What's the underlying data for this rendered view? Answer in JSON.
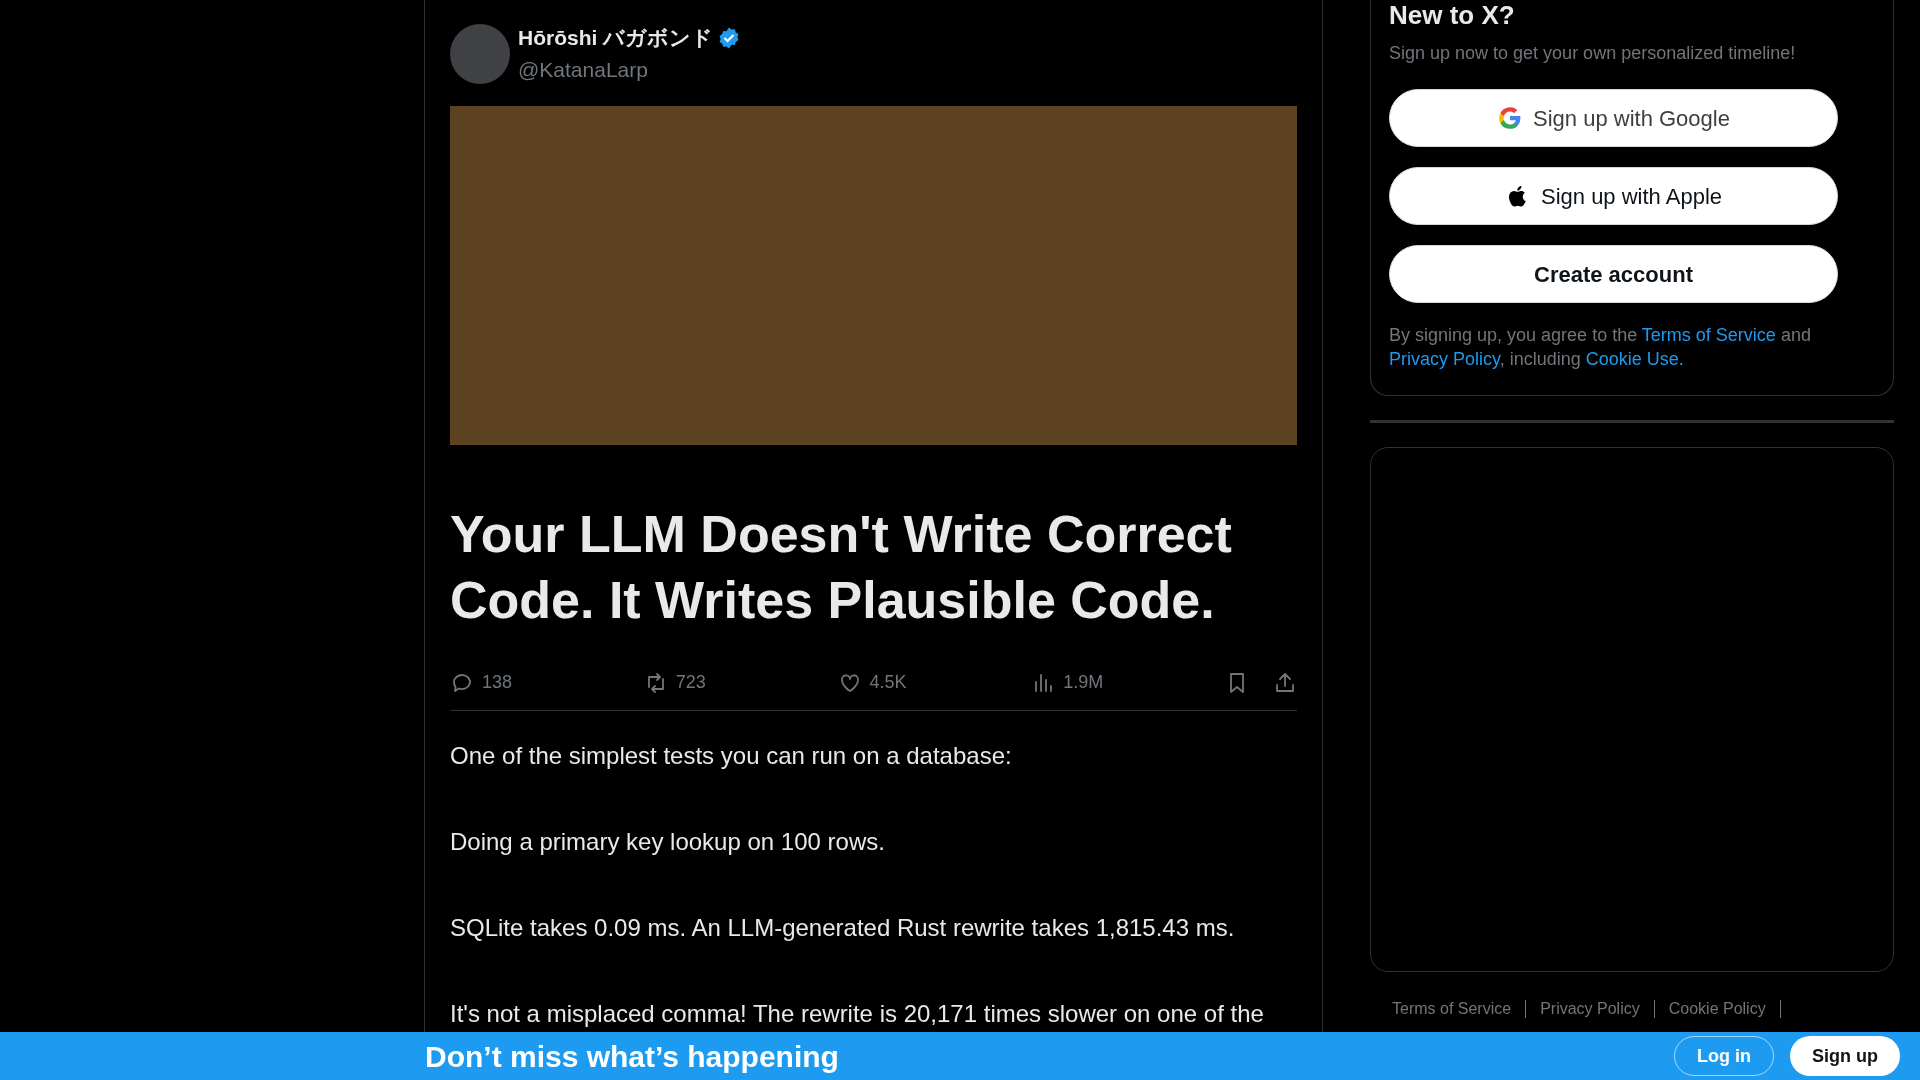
{
  "tweet": {
    "author": {
      "name": "Hōrōshi バガボンド",
      "verified": true,
      "handle": "@KatanaLarp"
    },
    "headline": "Your LLM Doesn't Write Correct Code. It Writes Plausible Code.",
    "actions": [
      {
        "kind": "reply",
        "count": "138"
      },
      {
        "kind": "repost",
        "count": "723"
      },
      {
        "kind": "like",
        "count": "4.5K"
      },
      {
        "kind": "views",
        "count": "1.9M"
      }
    ],
    "paragraphs": [
      "One of the simplest tests you can run on a database:",
      "Doing a primary key lookup on 100 rows.",
      "SQLite takes 0.09 ms. An LLM-generated Rust rewrite takes 1,815.43 ms.",
      "It's not a misplaced comma! The rewrite is 20,171 times slower on one of the"
    ]
  },
  "signup": {
    "title": "New to X?",
    "subtitle": "Sign up now to get your own personalized timeline!",
    "buttons": [
      {
        "kind": "google",
        "label": "Sign up with Google"
      },
      {
        "kind": "apple",
        "label": "Sign up with Apple"
      },
      {
        "kind": "create",
        "label": "Create account"
      }
    ],
    "legal": [
      {
        "kind": "text",
        "text": "By signing up, you agree to the "
      },
      {
        "kind": "link",
        "text": "Terms of Service"
      },
      {
        "kind": "text",
        "text": " and "
      },
      {
        "kind": "link",
        "text": "Privacy Policy"
      },
      {
        "kind": "text",
        "text": ", including "
      },
      {
        "kind": "link",
        "text": "Cookie Use."
      }
    ]
  },
  "footer_links": [
    "Terms of Service",
    "Privacy Policy",
    "Cookie Policy"
  ],
  "bottom_bar": {
    "title": "Don’t miss what’s happening",
    "buttons": [
      {
        "kind": "login",
        "label": "Log in"
      },
      {
        "kind": "signup",
        "label": "Sign up"
      }
    ]
  }
}
